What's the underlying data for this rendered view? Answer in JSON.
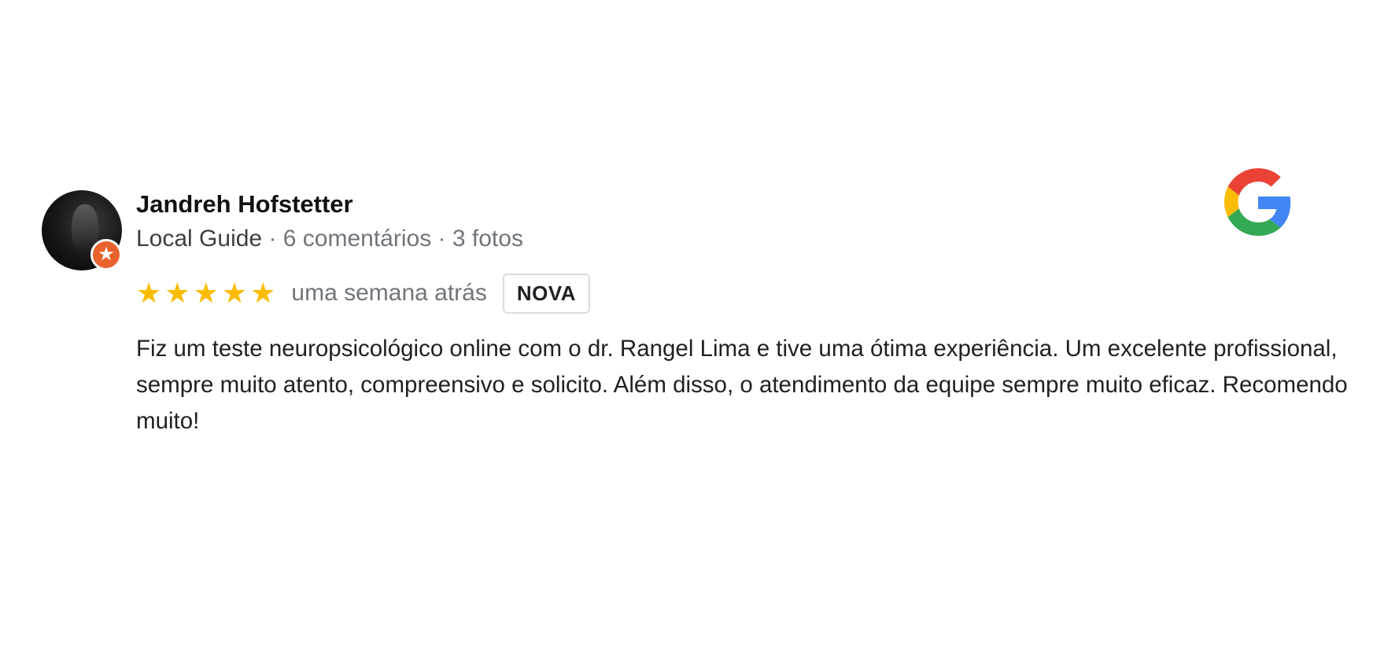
{
  "review": {
    "author_name": "Jandreh Hofstetter",
    "author_title": "Local Guide",
    "separator": " · ",
    "reviews_count": "6 comentários",
    "photos_count": "3 fotos",
    "rating": 5,
    "rating_max": 5,
    "time_ago": "uma semana atrás",
    "badge_label": "NOVA",
    "text": "Fiz um teste neuropsicológico online com o dr. Rangel Lima e tive uma ótima experiência. Um excelente profissional, sempre muito atento, compreensivo e solicito. Além disso, o atendimento da equipe sempre muito eficaz. Recomendo muito!"
  },
  "icons": {
    "avatar_badge": "local-guide-star-icon",
    "star": "star-icon",
    "source_logo": "google-logo-icon"
  },
  "colors": {
    "star": "#fbbc04",
    "badge_orange": "#e8622c",
    "google_blue": "#4285f4",
    "google_red": "#ea4335",
    "google_yellow": "#fbbc05",
    "google_green": "#34a853"
  }
}
